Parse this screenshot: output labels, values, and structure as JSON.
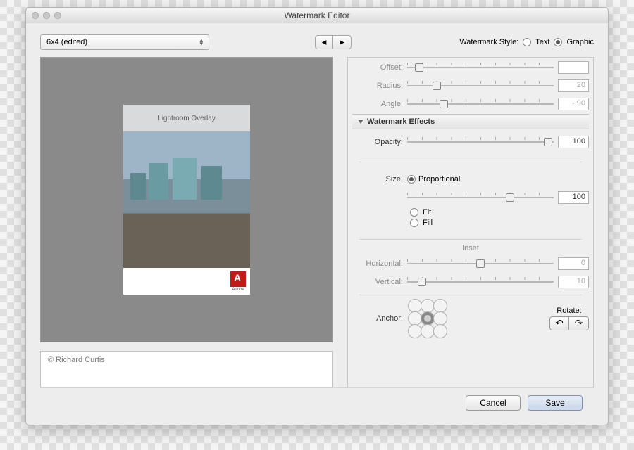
{
  "window": {
    "title": "Watermark Editor"
  },
  "preset": {
    "selected": "6x4 (edited)"
  },
  "style": {
    "label": "Watermark Style:",
    "text_label": "Text",
    "graphic_label": "Graphic",
    "selected": "graphic"
  },
  "preview": {
    "overlay_text": "Lightroom Overlay",
    "logo_caption": "Adobe"
  },
  "copyright": {
    "text": "© Richard Curtis"
  },
  "shadow": {
    "offset_label": "Offset:",
    "radius_label": "Radius:",
    "radius_value": "20",
    "angle_label": "Angle:",
    "angle_value": "- 90"
  },
  "effects": {
    "header": "Watermark Effects",
    "opacity_label": "Opacity:",
    "opacity_value": "100",
    "size_label": "Size:",
    "size_options": {
      "proportional": "Proportional",
      "fit": "Fit",
      "fill": "Fill"
    },
    "size_value": "100",
    "inset_label": "Inset",
    "h_label": "Horizontal:",
    "h_value": "0",
    "v_label": "Vertical:",
    "v_value": "10",
    "anchor_label": "Anchor:",
    "rotate_label": "Rotate:"
  },
  "buttons": {
    "cancel": "Cancel",
    "save": "Save"
  }
}
